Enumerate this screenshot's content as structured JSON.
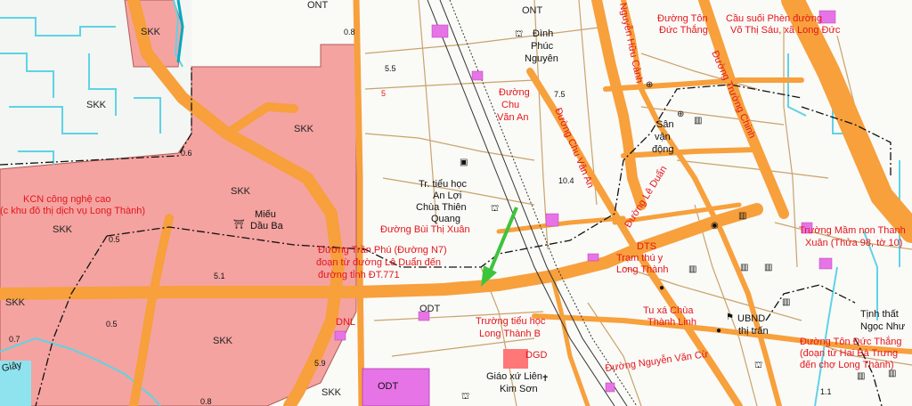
{
  "map": {
    "zones": {
      "skk_label": "SKK",
      "ont_label": "ONT",
      "odt_label": "ODT",
      "dnl_label": "DNL",
      "dts_label": "DTS",
      "dgd_label": "DGD"
    },
    "places": {
      "kcn": "KCN công nghệ cao",
      "kcn2": "(c khu đô thị dịch vụ Long Thành)",
      "mieu1": "Miếu",
      "mieu2": "Dầu Ba",
      "dinh1": "Đình",
      "dinh2": "Phúc",
      "dinh3": "Nguyên",
      "th_anloi1": "Tr. tiểu học",
      "th_anloi2": "An Lợi",
      "chua1": "Chùa Thiên",
      "chua2": "Quang",
      "sanvan1": "Sân",
      "sanvan2": "vận",
      "sanvan3": "động",
      "th_lt1": "Trường tiểu học",
      "th_lt2": "Long Thành B",
      "giaoxu1": "Giáo xứ Liên",
      "giaoxu2": "Kim Sơn",
      "tramthuy1": "Trạm thú y",
      "tramthuy2": "Long Thành",
      "tuxa1": "Tu xá Chùa",
      "tuxa2": "Thành Linh",
      "ubnd1": "UBND",
      "ubnd2": "thị trấn",
      "tinhthat1": "Tịnh thất",
      "tinhthat2": "Ngọc Như",
      "mamnon1": "Trường Mầm non Thanh",
      "mamnon2": "Xuân (Thửa 98, tờ 10)"
    },
    "roads": {
      "tonducthang_top1": "Đường Tôn",
      "tonducthang_top2": "Đức Thắng",
      "causuoi1": "Cầu suối Phèn đường",
      "causuoi2": "Võ Thị Sáu, xã Long Đức",
      "nguyenhuucanh": "Nguyễn Hữu Cảnh",
      "truongchinh": "Đường Trường Chinh",
      "chuvanan1": "Đường",
      "chuvanan2": "Chu",
      "chuvanan3": "Văn An",
      "chuvanan_v": "Đường Chu Văn An",
      "leduan": "Đường Lê Duẩn",
      "buithixuan": "Đường Bùi Thị Xuân",
      "tranphu1": "Đường Trần Phú (Đường N7)",
      "tranphu2": "đoạn từ đường Lê Duẩn đến",
      "tranphu3": "đường tỉnh ĐT.771",
      "nguyenvancu": "Đường Nguyễn Văn Cừ",
      "tdt_bottom1": "Đường Tôn Đức Thắng",
      "tdt_bottom2": "(đoạn từ Hai Bà Trưng",
      "tdt_bottom3": "đến chợ Long Thành)",
      "giay": "Giây"
    },
    "elevations": [
      "0.8",
      "5.5",
      "7.5",
      "0.6",
      "10.4",
      "0.5",
      "5.1",
      "0.7",
      "0.5",
      "5.9",
      "0.8",
      "1.1",
      "5"
    ],
    "colors": {
      "industrial_zone": "#f4a3a0",
      "main_road": "#f7a03c",
      "water": "#5fd3e6",
      "label_red": "#e4161b",
      "odt_block": "#e774e7"
    }
  }
}
